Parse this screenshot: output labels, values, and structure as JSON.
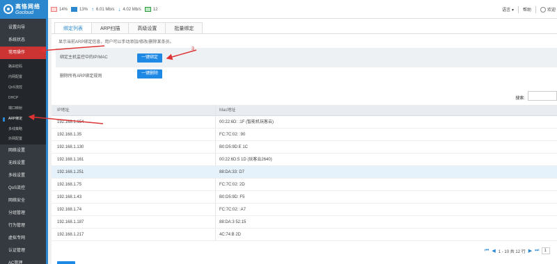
{
  "brand": {
    "name_cn": "高恪网络",
    "name_en": "Gocloud"
  },
  "stats": {
    "cpu": "14%",
    "mem": "13%",
    "upload": "6.01 Mb/s",
    "download": "4.02 Mb/s",
    "online": "12"
  },
  "top_right": {
    "language": "语言",
    "help": "帮助",
    "user": "欢迎"
  },
  "sidebar": {
    "items": [
      {
        "label": "设置向导"
      },
      {
        "label": "系统状态"
      },
      {
        "label": "常用操作"
      }
    ],
    "sub_items": [
      {
        "label": "路由密码"
      },
      {
        "label": "内网配置"
      },
      {
        "label": "QoS流控"
      },
      {
        "label": "DHCP"
      },
      {
        "label": "端口映射"
      },
      {
        "label": "ARP绑定"
      },
      {
        "label": "多线策略"
      },
      {
        "label": "外网配置"
      }
    ],
    "items_after": [
      {
        "label": "网络设置"
      },
      {
        "label": "无线设置"
      },
      {
        "label": "多线设置"
      },
      {
        "label": "QoS流控"
      },
      {
        "label": "网络安全"
      },
      {
        "label": "分组管理"
      },
      {
        "label": "行为管理"
      },
      {
        "label": "虚拟专网"
      },
      {
        "label": "认证管理"
      },
      {
        "label": "AC管理"
      }
    ]
  },
  "tabs": [
    {
      "label": "绑定列表"
    },
    {
      "label": "ARP扫描"
    },
    {
      "label": "高级设置"
    },
    {
      "label": "批量绑定"
    }
  ],
  "notice": "显示当前ARP绑定信息，用户可以手动添加/修改/删除某条员。",
  "actions": {
    "bind_label": "绑定主机监控中的IP/MAC",
    "bind_button": "一键绑定",
    "delete_label": "删除所有ARP绑定规则",
    "delete_button": "一键删除",
    "annotation": "3"
  },
  "search": {
    "label": "搜索:",
    "placeholder": ""
  },
  "table": {
    "headers": [
      "IP地址",
      "Mac地址"
    ],
    "rows": [
      {
        "ip": "192.168.1.154",
        "mac": "00:22:6D:     :1F (智能机玩客云)"
      },
      {
        "ip": "192.168.1.35",
        "mac": "FC:7C:02:     :90"
      },
      {
        "ip": "192.168.1.130",
        "mac": "B0:D5:9D:E     1C"
      },
      {
        "ip": "192.168.1.161",
        "mac": "00:22:6D:5     1D (玩客云2640)"
      },
      {
        "ip": "192.168.1.251",
        "mac": "88:DA:33:     D7"
      },
      {
        "ip": "192.168.1.75",
        "mac": "FC:7C:02:     2D"
      },
      {
        "ip": "192.168.1.43",
        "mac": "B0:D5:9D:     F5"
      },
      {
        "ip": "192.168.1.74",
        "mac": "FC:7C:02:     :A7"
      },
      {
        "ip": "192.168.1.187",
        "mac": "88:DA:3     52:15"
      },
      {
        "ip": "192.168.1.217",
        "mac": "4C:74:B     2D"
      }
    ]
  },
  "pager": {
    "summary": "1 - 10 共 12 行",
    "page": "1"
  },
  "colors": {
    "accent": "#2b88cf",
    "sidebar_bg": "#343a40",
    "active_red": "#cc3333",
    "annotation_red": "#dd3333"
  }
}
